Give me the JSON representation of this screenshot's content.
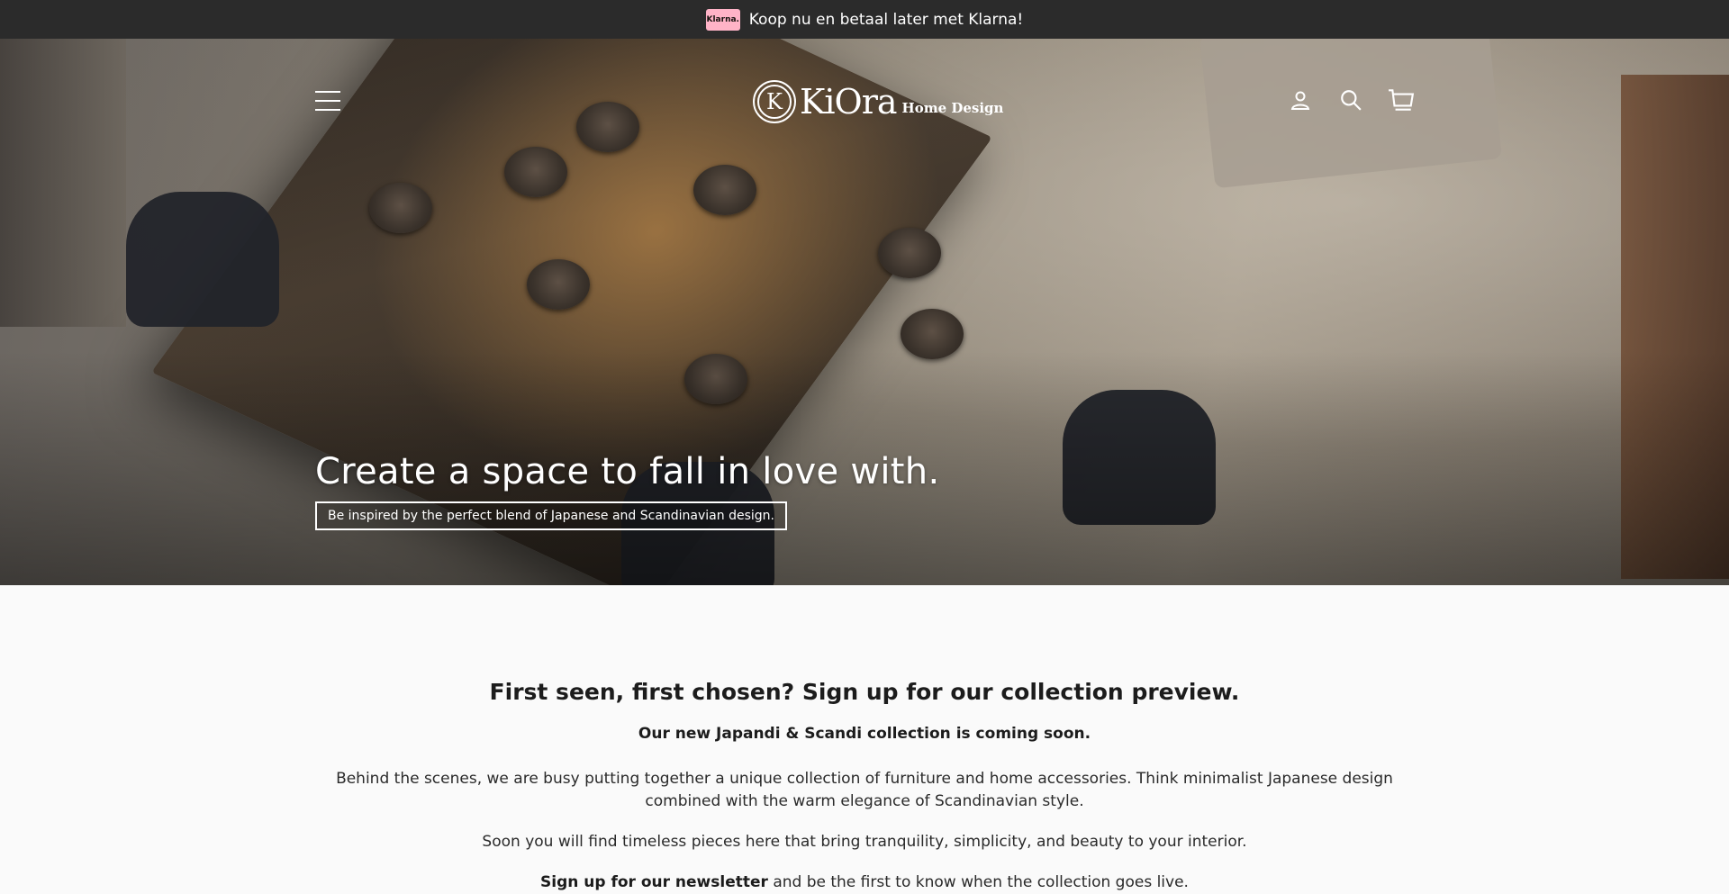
{
  "announcement": {
    "badge": "Klarna.",
    "text": "Koop nu en betaal later met Klarna!"
  },
  "header": {
    "logo_letter": "K",
    "logo_name": "KiOra",
    "logo_tagline": "Home Design",
    "icons": [
      "menu-icon",
      "account-icon",
      "search-icon",
      "cart-icon"
    ]
  },
  "hero": {
    "title": "Create a space to fall in love with.",
    "subtitle": "Be inspired by the perfect blend of Japanese and Scandinavian design."
  },
  "content": {
    "heading": "First seen, first chosen? Sign up for our collection preview.",
    "announcement": "Our new Japandi & Scandi collection is coming soon.",
    "paragraph1": "Behind the scenes, we are busy putting together a unique collection of furniture and home accessories. Think minimalist Japanese design combined with the warm elegance of Scandinavian style.",
    "paragraph2": "Soon you will find timeless pieces here that bring tranquility, simplicity, and beauty to your interior.",
    "signup_link": "Sign up for our newsletter",
    "signup_rest": " and be the first to know when the collection goes live."
  },
  "colors": {
    "announcement_bg": "#2b2b2b",
    "klarna_pink": "#ffb3c7",
    "page_bg": "#fafafa",
    "text": "#1c1c1c"
  }
}
